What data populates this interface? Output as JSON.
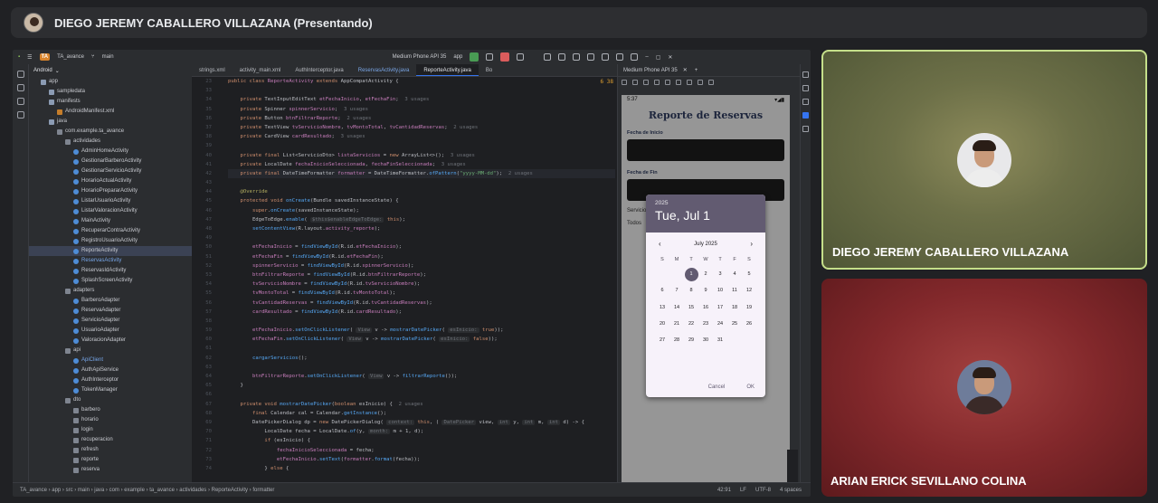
{
  "meet": {
    "presenter_label": "DIEGO JEREMY CABALLERO VILLAZANA (Presentando)",
    "participants": [
      {
        "name": "DIEGO JEREMY CABALLERO VILLAZANA"
      },
      {
        "name": "ARIAN ERICK SEVILLANO COLINA"
      }
    ]
  },
  "ide": {
    "project_name": "TA_avance",
    "project_badge": "TA",
    "branch": "main",
    "device": "Medium Phone API 35",
    "run_config": "app",
    "panel_title": "Android",
    "tabs": [
      "strings.xml",
      "activity_main.xml",
      "AuthInterceptor.java",
      "ReservasActivity.java",
      "ReporteActivity.java",
      "Bo"
    ],
    "emulator_tab": "Medium Phone API 35",
    "tree": [
      {
        "label": "app",
        "indent": 1,
        "icon": "folder"
      },
      {
        "label": "sampledata",
        "indent": 2,
        "icon": "folder"
      },
      {
        "label": "manifests",
        "indent": 2,
        "icon": "folder"
      },
      {
        "label": "AndroidManifest.xml",
        "indent": 3,
        "icon": "xml"
      },
      {
        "label": "java",
        "indent": 2,
        "icon": "folder"
      },
      {
        "label": "com.example.ta_avance",
        "indent": 3,
        "icon": "pkg"
      },
      {
        "label": "actividades",
        "indent": 4,
        "icon": "pkg"
      },
      {
        "label": "AdminHomeActivity",
        "indent": 5,
        "icon": "class"
      },
      {
        "label": "GestionarBarberoActivity",
        "indent": 5,
        "icon": "class"
      },
      {
        "label": "GestionarServicioActivity",
        "indent": 5,
        "icon": "class"
      },
      {
        "label": "HorarioActualActivity",
        "indent": 5,
        "icon": "class"
      },
      {
        "label": "HorarioPrepararActivity",
        "indent": 5,
        "icon": "class"
      },
      {
        "label": "ListarUsuarioActivity",
        "indent": 5,
        "icon": "class"
      },
      {
        "label": "ListarValoracionActivity",
        "indent": 5,
        "icon": "class"
      },
      {
        "label": "MainActivity",
        "indent": 5,
        "icon": "class"
      },
      {
        "label": "RecuperarContraActivity",
        "indent": 5,
        "icon": "class"
      },
      {
        "label": "RegistroUsuarioActivity",
        "indent": 5,
        "icon": "class"
      },
      {
        "label": "ReporteActivity",
        "indent": 5,
        "icon": "class",
        "selected": true
      },
      {
        "label": "ReservasActivity",
        "indent": 5,
        "icon": "class",
        "blue": true
      },
      {
        "label": "ReservasIdActivity",
        "indent": 5,
        "icon": "class"
      },
      {
        "label": "SplashScreenActivity",
        "indent": 5,
        "icon": "class"
      },
      {
        "label": "adapters",
        "indent": 4,
        "icon": "pkg"
      },
      {
        "label": "BarberoAdapter",
        "indent": 5,
        "icon": "class"
      },
      {
        "label": "ReservaAdapter",
        "indent": 5,
        "icon": "class"
      },
      {
        "label": "ServicioAdapter",
        "indent": 5,
        "icon": "class"
      },
      {
        "label": "UsuarioAdapter",
        "indent": 5,
        "icon": "class"
      },
      {
        "label": "ValoracionAdapter",
        "indent": 5,
        "icon": "class"
      },
      {
        "label": "api",
        "indent": 4,
        "icon": "pkg"
      },
      {
        "label": "ApiClient",
        "indent": 5,
        "icon": "class",
        "blue": true
      },
      {
        "label": "AuthApiService",
        "indent": 5,
        "icon": "class"
      },
      {
        "label": "AuthInterceptor",
        "indent": 5,
        "icon": "class"
      },
      {
        "label": "TokenManager",
        "indent": 5,
        "icon": "class"
      },
      {
        "label": "dto",
        "indent": 4,
        "icon": "pkg"
      },
      {
        "label": "barbero",
        "indent": 5,
        "icon": "pkg"
      },
      {
        "label": "horario",
        "indent": 5,
        "icon": "pkg"
      },
      {
        "label": "login",
        "indent": 5,
        "icon": "pkg"
      },
      {
        "label": "recuperacion",
        "indent": 5,
        "icon": "pkg"
      },
      {
        "label": "refresh",
        "indent": 5,
        "icon": "pkg"
      },
      {
        "label": "reporte",
        "indent": 5,
        "icon": "pkg"
      },
      {
        "label": "reserva",
        "indent": 5,
        "icon": "pkg"
      }
    ],
    "line_numbers": [
      "23",
      "33",
      "34",
      "35",
      "36",
      "37",
      "38",
      "39",
      "40",
      "41",
      "42",
      "43",
      "44",
      "45",
      "46",
      "47",
      "48",
      "49",
      "50",
      "51",
      "52",
      "53",
      "54",
      "55",
      "56",
      "57",
      "58",
      "59",
      "60",
      "61",
      "62",
      "63",
      "64",
      "65",
      "66",
      "67",
      "68",
      "69",
      "70",
      "71",
      "72",
      "73",
      "74"
    ],
    "code": [
      "<span class=\"kw\">public class</span> <span class=\"fld\">ReporteActivity</span> <span class=\"kw\">extends</span> AppCompatActivity {",
      "",
      "    <span class=\"kw\">private</span> TextInputEditText <span class=\"fld\">etFechaInicio</span>, <span class=\"fld\">etFechaFin</span>;  <span class=\"usage\">3 usages</span>",
      "    <span class=\"kw\">private</span> Spinner <span class=\"fld\">spinnerServicio</span>;  <span class=\"usage\">3 usages</span>",
      "    <span class=\"kw\">private</span> Button <span class=\"fld\">btnFiltrarReporte</span>;  <span class=\"usage\">2 usages</span>",
      "    <span class=\"kw\">private</span> TextView <span class=\"fld\">tvServicioNombre</span>, <span class=\"fld\">tvMontoTotal</span>, <span class=\"fld\">tvCantidadReservas</span>;  <span class=\"usage\">2 usages</span>",
      "    <span class=\"kw\">private</span> CardView <span class=\"fld\">cardResultado</span>;  <span class=\"usage\">3 usages</span>",
      "",
      "    <span class=\"kw\">private final</span> List&lt;ServicioDto&gt; <span class=\"fld\">listaServicios</span> = <span class=\"kw\">new</span> ArrayList&lt;&gt;();  <span class=\"usage\">3 usages</span>",
      "    <span class=\"kw\">private</span> LocalDate <span class=\"fld\">fechaInicioSeleccionada</span>, <span class=\"fld\">fechaFinSeleccionada</span>;  <span class=\"usage\">3 usages</span>",
      "    <span class=\"kw\">private final</span> DateTimeFormatter <span class=\"fld\">formatter</span> = DateTimeFormatter.<span class=\"fn\">ofPattern</span>(<span class=\"str\">\"yyyy-MM-dd\"</span>);  <span class=\"usage\">2 usages</span>",
      "",
      "    <span class=\"ann\">@Override</span>",
      "    <span class=\"kw\">protected void</span> <span class=\"fn\">onCreate</span>(Bundle savedInstanceState) {",
      "        <span class=\"kw\">super</span>.<span class=\"fn\">onCreate</span>(savedInstanceState);",
      "        EdgeToEdge.<span class=\"fn\">enable</span>( <span class=\"hint\">$this$enableEdgeToEdge:</span> <span class=\"kw\">this</span>);",
      "        <span class=\"fn\">setContentView</span>(R.layout.<span class=\"fld\">activity_reporte</span>);",
      "",
      "        <span class=\"fld\">etFechaInicio</span> = <span class=\"fn\">findViewById</span>(R.id.<span class=\"fld\">etFechaInicio</span>);",
      "        <span class=\"fld\">etFechaFin</span> = <span class=\"fn\">findViewById</span>(R.id.<span class=\"fld\">etFechaFin</span>);",
      "        <span class=\"fld\">spinnerServicio</span> = <span class=\"fn\">findViewById</span>(R.id.<span class=\"fld\">spinnerServicio</span>);",
      "        <span class=\"fld\">btnFiltrarReporte</span> = <span class=\"fn\">findViewById</span>(R.id.<span class=\"fld\">btnFiltrarReporte</span>);",
      "        <span class=\"fld\">tvServicioNombre</span> = <span class=\"fn\">findViewById</span>(R.id.<span class=\"fld\">tvServicioNombre</span>);",
      "        <span class=\"fld\">tvMontoTotal</span> = <span class=\"fn\">findViewById</span>(R.id.<span class=\"fld\">tvMontoTotal</span>);",
      "        <span class=\"fld\">tvCantidadReservas</span> = <span class=\"fn\">findViewById</span>(R.id.<span class=\"fld\">tvCantidadReservas</span>);",
      "        <span class=\"fld\">cardResultado</span> = <span class=\"fn\">findViewById</span>(R.id.<span class=\"fld\">cardResultado</span>);",
      "",
      "        <span class=\"fld\">etFechaInicio</span>.<span class=\"fn\">setOnClickListener</span>( <span class=\"hint\">View</span> v -&gt; <span class=\"fn\">mostrarDatePicker</span>( <span class=\"hint\">esInicio:</span> <span class=\"kw\">true</span>));",
      "        <span class=\"fld\">etFechaFin</span>.<span class=\"fn\">setOnClickListener</span>( <span class=\"hint\">View</span> v -&gt; <span class=\"fn\">mostrarDatePicker</span>( <span class=\"hint\">esInicio:</span> <span class=\"kw\">false</span>));",
      "",
      "        <span class=\"fn\">cargarServicios</span>();",
      "",
      "        <span class=\"fld\">btnFiltrarReporte</span>.<span class=\"fn\">setOnClickListener</span>( <span class=\"hint\">View</span> v -&gt; <span class=\"fn\">filtrarReporte</span>());",
      "    }",
      "",
      "    <span class=\"kw\">private void</span> <span class=\"fn\">mostrarDatePicker</span>(<span class=\"kw\">boolean</span> esInicio) {  <span class=\"usage\">2 usages</span>",
      "        <span class=\"kw\">final</span> Calendar cal = Calendar.<span class=\"fn\">getInstance</span>();",
      "        DatePickerDialog dp = <span class=\"kw\">new</span> DatePickerDialog( <span class=\"hint\">context:</span> <span class=\"kw\">this</span>, ( <span class=\"hint\">DatePicker</span> view, <span class=\"hint\">int</span> y, <span class=\"hint\">int</span> m, <span class=\"hint\">int</span> d) -&gt; {",
      "            LocalDate fecha = LocalDate.<span class=\"fn\">of</span>(y, <span class=\"hint\">month:</span> m + 1, d);",
      "            <span class=\"kw\">if</span> (esInicio) {",
      "                <span class=\"fld\">fechaInicioSeleccionada</span> = fecha;",
      "                <span class=\"fld\">etFechaInicio</span>.<span class=\"fn\">setText</span>(<span class=\"fld\">formatter</span>.<span class=\"fn\">format</span>(fecha));",
      "            } <span class=\"kw\">else</span> {"
    ],
    "status": {
      "breadcrumb": [
        "TA_avance",
        "app",
        "src",
        "main",
        "java",
        "com",
        "example",
        "ta_avance",
        "actividades",
        "ReporteActivity",
        "formatter"
      ],
      "position": "42:91",
      "line_sep": "LF",
      "encoding": "UTF-8",
      "indent": "4 spaces"
    },
    "editor_hint": "6  38"
  },
  "phone": {
    "time": "5:37",
    "title": "Reporte de Reservas",
    "label_start": "Fecha de Inicio",
    "label_end": "Fecha de Fin",
    "label_servicio": "Servicio",
    "spinner_value": "Todos",
    "date_picker": {
      "year": "2025",
      "selected_label": "Tue, Jul 1",
      "month_label": "July 2025",
      "weekdays": [
        "S",
        "M",
        "T",
        "W",
        "T",
        "F",
        "S"
      ],
      "leading_blanks": 2,
      "days": [
        "1",
        "2",
        "3",
        "4",
        "5",
        "6",
        "7",
        "8",
        "9",
        "10",
        "11",
        "12",
        "13",
        "14",
        "15",
        "16",
        "17",
        "18",
        "19",
        "20",
        "21",
        "22",
        "23",
        "24",
        "25",
        "26",
        "27",
        "28",
        "29",
        "30",
        "31"
      ],
      "selected_day": "1",
      "cancel": "Cancel",
      "ok": "OK"
    }
  }
}
